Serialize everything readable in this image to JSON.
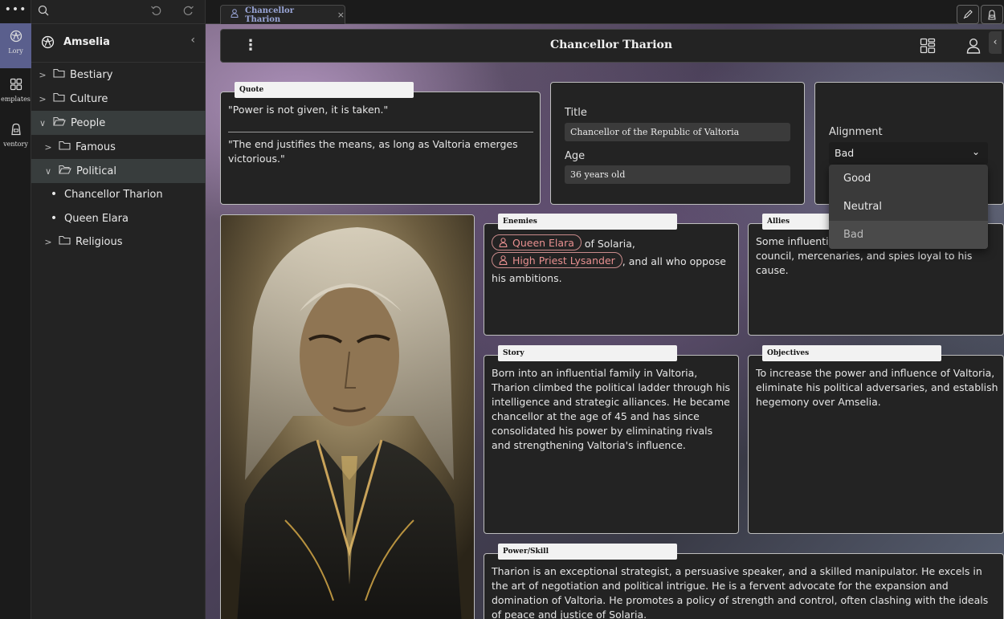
{
  "rail": {
    "items": [
      {
        "label": "Lory",
        "icon": "lory-icon"
      },
      {
        "label": "emplates",
        "icon": "templates-icon"
      },
      {
        "label": "ventory",
        "icon": "inventory-icon"
      }
    ]
  },
  "sidebar": {
    "world_title": "Amselia",
    "tree": [
      {
        "label": "Bestiary",
        "kind": "folder",
        "expanded": false
      },
      {
        "label": "Culture",
        "kind": "folder",
        "expanded": false
      },
      {
        "label": "People",
        "kind": "folder",
        "expanded": true
      },
      {
        "label": "Famous",
        "kind": "folder",
        "expanded": false
      },
      {
        "label": "Political",
        "kind": "folder",
        "expanded": true
      },
      {
        "label": "Chancellor Tharion",
        "kind": "page"
      },
      {
        "label": "Queen Elara",
        "kind": "page"
      },
      {
        "label": "Religious",
        "kind": "folder",
        "expanded": false
      }
    ]
  },
  "tabs": [
    {
      "label": "Chancellor Tharion",
      "close": "×"
    }
  ],
  "page": {
    "title": "Chancellor Tharion",
    "quote": {
      "tag": "Quote",
      "line1": "\"Power is not given, it is taken.\"",
      "line2": "\"The end justifies the means, as long as Valtoria emerges victorious.\""
    },
    "title_field": {
      "label": "Title",
      "value": "Chancellor of the Republic of Valtoria"
    },
    "age_field": {
      "label": "Age",
      "value": "36 years old"
    },
    "alignment": {
      "label": "Alignment",
      "value": "Bad",
      "options": [
        "Good",
        "Neutral",
        "Bad"
      ]
    },
    "enemies": {
      "tag": "Enemies",
      "chip1": "Queen Elara",
      "text1": " of Solaria,",
      "chip2": "High Priest Lysander",
      "text2": ", and all who oppose",
      "text3": "his ambitions."
    },
    "allies": {
      "tag": "Allies",
      "line1": "Some influentia",
      "line2": "council, mercenaries, and spies loyal to his cause."
    },
    "story": {
      "tag": "Story",
      "text": "Born into an influential family in Valtoria, Tharion climbed the political ladder through his intelligence and strategic alliances. He became chancellor at the age of 45 and has since consolidated his power by eliminating rivals and strengthening Valtoria's influence."
    },
    "objectives": {
      "tag": "Objectives",
      "text": "To increase the power and influence of Valtoria, eliminate his political adversaries, and establish hegemony over Amselia."
    },
    "power": {
      "tag": "Power/Skill",
      "text": "Tharion is an exceptional strategist, a persuasive speaker, and a skilled manipulator. He excels in the art of negotiation and political intrigue. He is a fervent advocate for the expansion and domination of Valtoria. He promotes a policy of strength and control, often clashing with the ideals of peace and justice of Solaria."
    }
  },
  "colors": {
    "accent": "#5a5f8d",
    "chip": "#e89090",
    "tab_text": "#9aa6d8"
  }
}
